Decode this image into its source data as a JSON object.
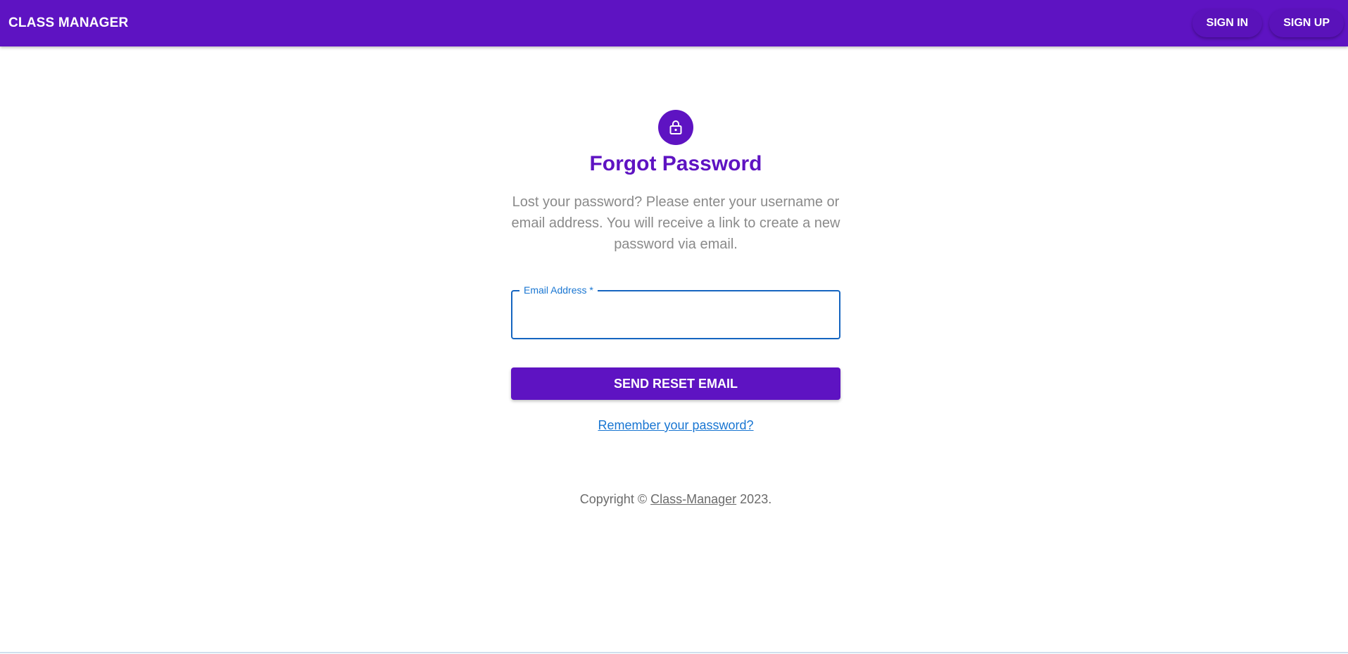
{
  "appbar": {
    "brand": "CLASS MANAGER",
    "nav": {
      "sign_in": "SIGN IN",
      "sign_up": "SIGN UP"
    }
  },
  "form": {
    "icon": "lock-icon",
    "title": "Forgot Password",
    "description": "Lost your password? Please enter your username or email address. You will receive a link to create a new password via email.",
    "email_label": "Email Address *",
    "email_value": "",
    "submit_label": "SEND RESET EMAIL",
    "remember_link": "Remember your password?"
  },
  "footer": {
    "prefix": "Copyright ©",
    "link": "Class-Manager",
    "suffix": "2023."
  },
  "colors": {
    "primary": "#5e13c2",
    "field_focus": "#1565c0",
    "link": "#1976d2"
  }
}
